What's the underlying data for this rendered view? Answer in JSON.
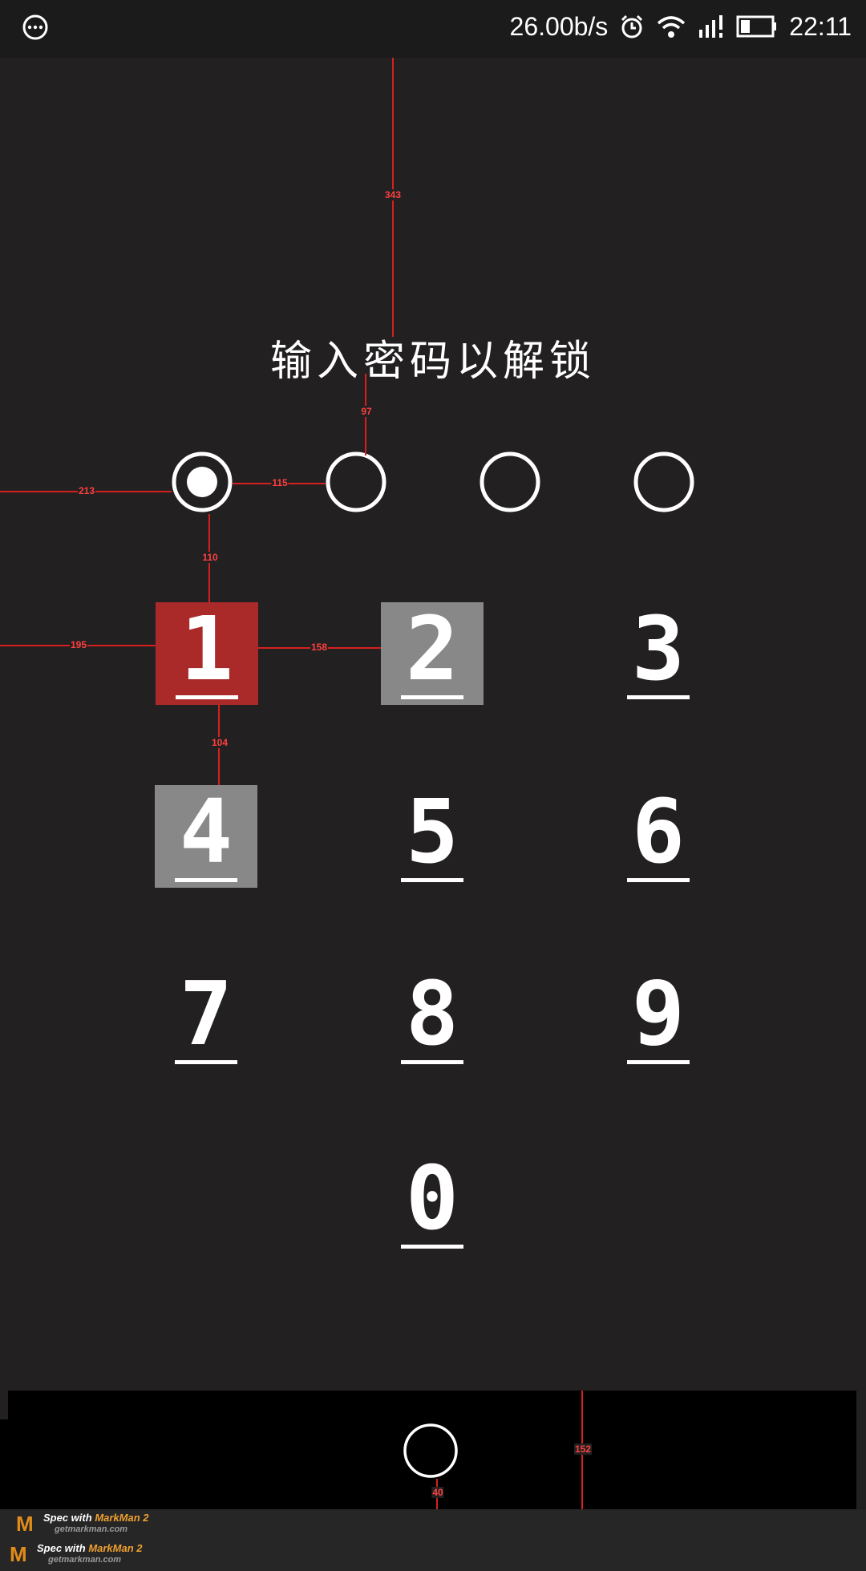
{
  "status_bar": {
    "speed": "26.00b/s",
    "time": "22:11",
    "icons": [
      "more-icon",
      "alarm-icon",
      "wifi-icon",
      "signal-icon",
      "battery-icon"
    ]
  },
  "lock_screen": {
    "title": "输入密码以解锁",
    "pin_length": 4,
    "entered_count": 1,
    "keys": [
      "1",
      "2",
      "3",
      "4",
      "5",
      "6",
      "7",
      "8",
      "9",
      "0"
    ],
    "pressed_key": "1",
    "highlighted_keys": [
      "2",
      "4"
    ]
  },
  "colors": {
    "background": "#222021",
    "pressed": "#aa2a2a",
    "highlighted": "#888888",
    "measure": "#d62020",
    "brand": "#f0a030"
  },
  "annotations": {
    "m343": "343",
    "m97": "97",
    "m213": "213",
    "m115": "115",
    "m110": "110",
    "m195": "195",
    "m158": "158",
    "m104": "104",
    "m152": "152",
    "m40": "40"
  },
  "watermark": {
    "line1_prefix": "Spec with",
    "brand": "MarkMan 2",
    "url": "getmarkman.com"
  }
}
